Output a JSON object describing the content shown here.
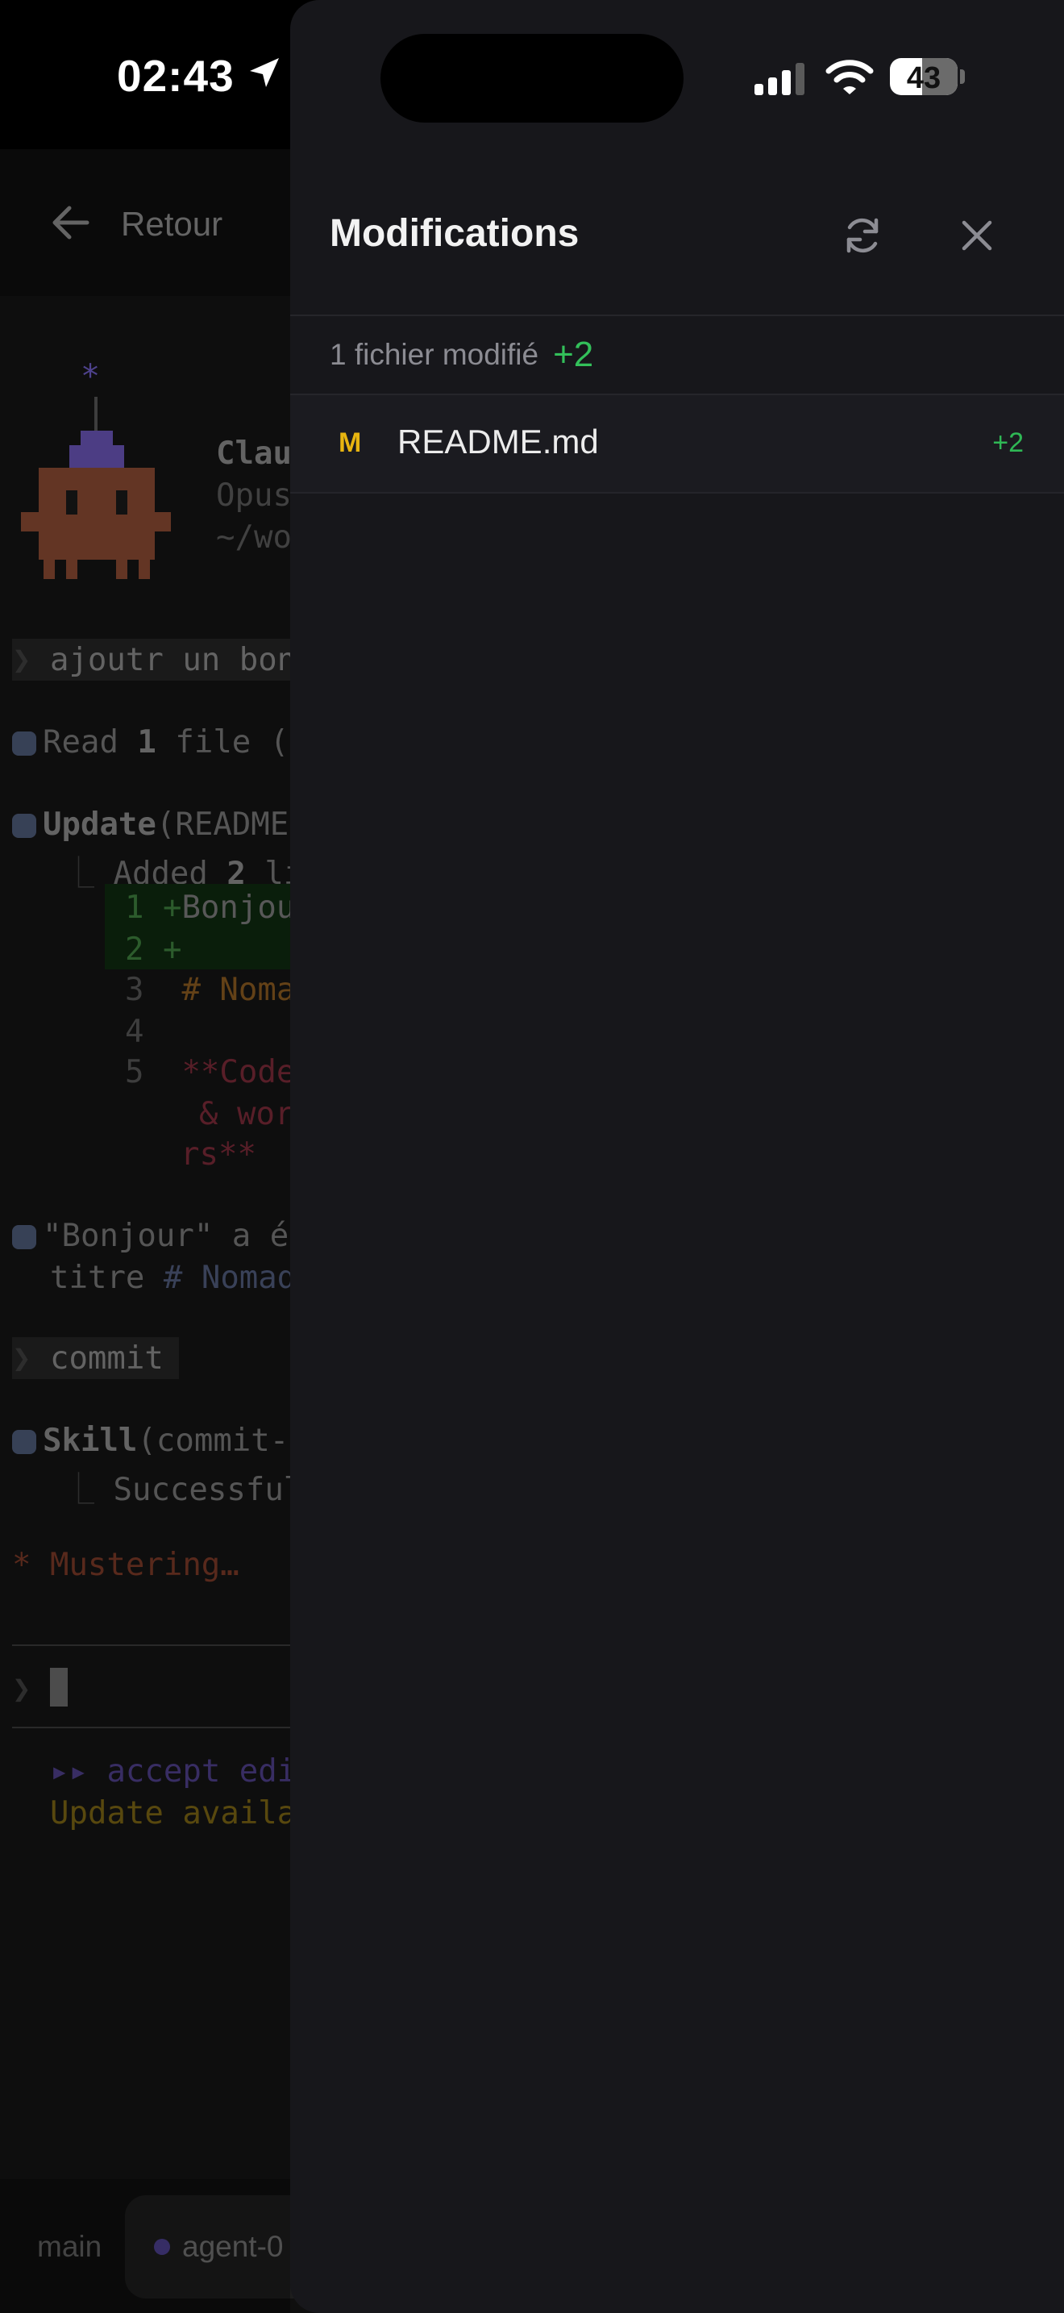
{
  "status_bar": {
    "time": "02:43",
    "battery": "43",
    "icons": [
      "location-arrow-icon",
      "cellular-signal-icon",
      "wifi-icon",
      "battery-icon"
    ]
  },
  "background_app": {
    "back_label": "Retour",
    "terminal": {
      "header_name": "Clau",
      "header_model": "Opus",
      "header_path": "~/wo",
      "prompt1": "ajoutr un bon",
      "read_prefix": "Read ",
      "read_count": "1",
      "read_suffix": " file (",
      "update_word": "Update",
      "update_rest": "(README",
      "added_prefix": "Added ",
      "added_count": "2",
      "added_suffix": " li",
      "diff_l1_num": "1",
      "diff_l1_text": "Bonjou",
      "diff_l2_num": "2",
      "diff_l3_num": "3",
      "diff_l3_text": "# Noma",
      "diff_l4_num": "4",
      "diff_l5_num": "5",
      "diff_l5_text": "**Code",
      "diff_l5b": "& wor",
      "diff_l5c": "rs**",
      "msg_line1": "\"Bonjour\" a é",
      "msg_line2_prefix": "titre ",
      "msg_line2_link": "# Nomad",
      "prompt2": "commit",
      "skill_word": "Skill",
      "skill_rest": "(commit-",
      "skill_result": "Successful",
      "mustering": "Mustering…",
      "accept_edits": "▸▸ accept edi",
      "update_available": "Update availa"
    },
    "tabs": {
      "main": "main",
      "agent": "agent-0"
    }
  },
  "panel": {
    "title": "Modifications",
    "summary_label": "1 fichier modifié",
    "summary_count": "+2",
    "files": [
      {
        "status": "M",
        "name": "README.md",
        "delta": "+2"
      }
    ]
  },
  "colors": {
    "panel_bg": "#17171b",
    "added_green": "#33c05a",
    "modified_yellow": "#e8b510"
  }
}
